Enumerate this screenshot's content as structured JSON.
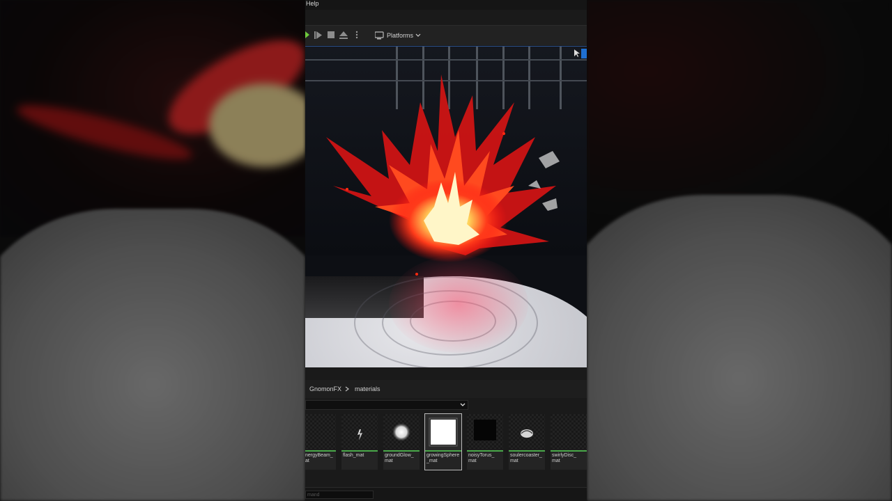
{
  "menu": {
    "help": "Help"
  },
  "toolbar": {
    "platforms_label": "Platforms"
  },
  "content_browser": {
    "breadcrumb": [
      "GnomonFX",
      "materials"
    ],
    "search_placeholder": "",
    "assets": [
      {
        "label": "nergyBeam_\nat"
      },
      {
        "label": "flash_mat"
      },
      {
        "label": "groundGlow_\nmat"
      },
      {
        "label": "growingSphere\n_mat"
      },
      {
        "label": "noisyTorus_\nmat"
      },
      {
        "label": "soulercoaster_\nmat"
      },
      {
        "label": "swirlyDisc_\nmat"
      }
    ]
  },
  "status": {
    "command_placeholder": "mand"
  },
  "colors": {
    "accent_blue": "#1f6fd1",
    "asset_underline": "#4aa84a",
    "play_green": "#6ec83c"
  }
}
